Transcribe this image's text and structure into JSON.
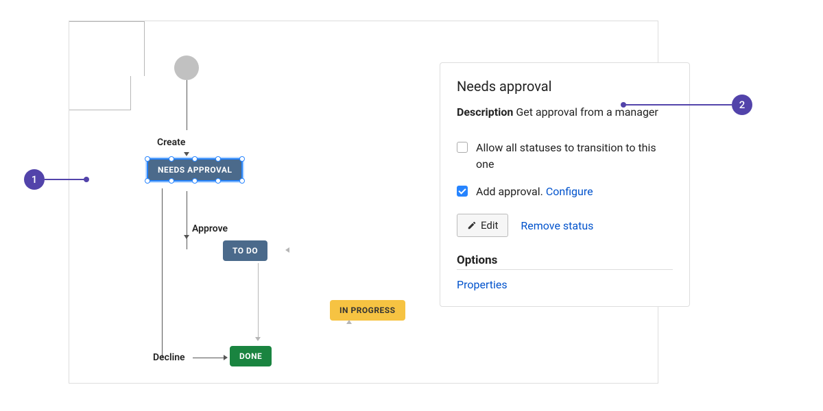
{
  "workflow": {
    "labels": {
      "create": "Create",
      "approve": "Approve",
      "decline": "Decline"
    },
    "statuses": {
      "needs_approval": "NEEDS APPROVAL",
      "todo": "TO DO",
      "in_progress": "IN PROGRESS",
      "done": "DONE"
    }
  },
  "panel": {
    "title": "Needs approval",
    "description_label": "Description",
    "description_text": "Get approval from a manager",
    "allow_all_label": "Allow all statuses to transition to this one",
    "add_approval_label": "Add approval. ",
    "configure_link": "Configure",
    "edit_label": "Edit",
    "remove_status_label": "Remove status",
    "options_header": "Options",
    "properties_link": "Properties"
  },
  "callouts": {
    "one": "1",
    "two": "2"
  }
}
